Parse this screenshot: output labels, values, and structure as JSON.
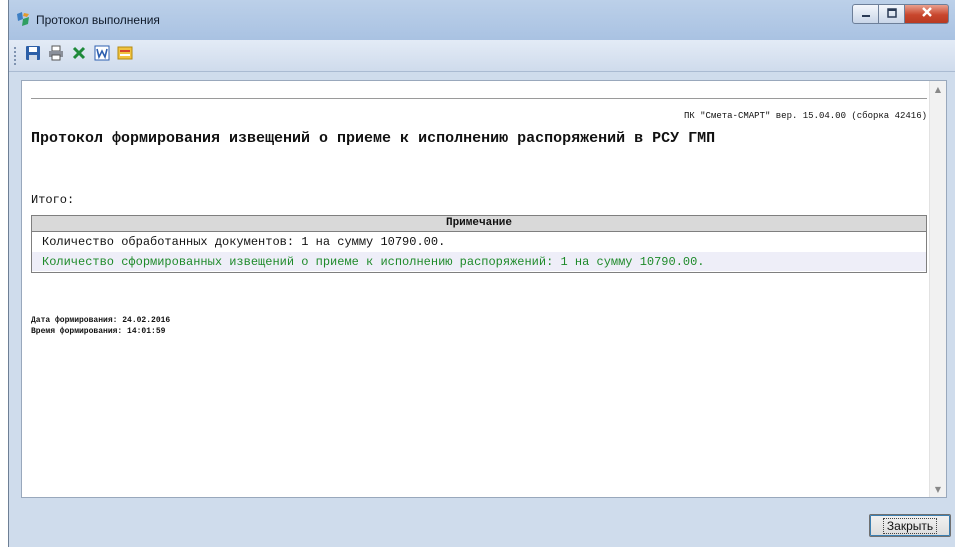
{
  "window": {
    "title": "Протокол выполнения"
  },
  "toolbar": {
    "buttons": [
      "save-icon",
      "print-icon",
      "excel-icon",
      "word-icon",
      "export-icon"
    ]
  },
  "report": {
    "version": "ПК \"Смета-СМАРТ\" вер. 15.04.00 (сборка 42416)",
    "title": "Протокол формирования извещений о приеме к исполнению распоряжений в РСУ ГМП",
    "total_label": "Итого:",
    "notes_header": "Примечание",
    "notes": [
      "Количество обработанных документов: 1 на сумму 10790.00.",
      "Количество сформированных извещений о приеме к исполнению распоряжений: 1 на сумму 10790.00."
    ],
    "date_line": "Дата формирования: 24.02.2016",
    "time_line": "Время формирования: 14:01:59"
  },
  "footer": {
    "close_label": "Закрыть"
  },
  "colors": {
    "accent_green": "#1e8a2a",
    "close_red": "#c8462d"
  }
}
